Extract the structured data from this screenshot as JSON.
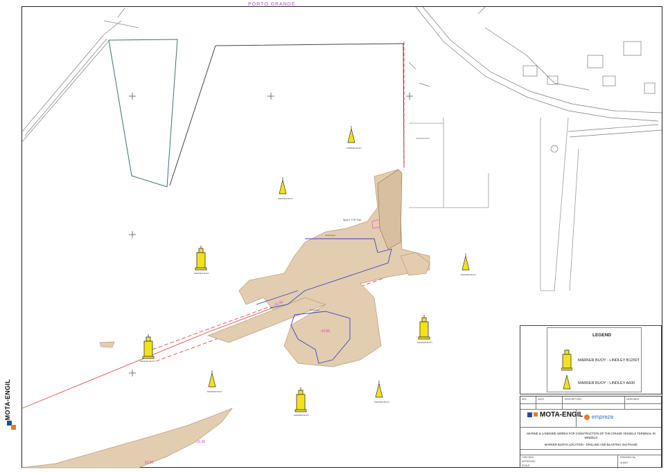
{
  "top_label": "PORTO GRANDE",
  "map_labels": {
    "spoil_area": "Spoil 1 TYP. Pad",
    "channel_depth_1": "-11.00",
    "channel_depth_2": "-10.00",
    "rock_area_1": "Rock Area",
    "rock_area_2": "Rock Area",
    "shore_1": "-10.00",
    "shore_2": "-10.00",
    "buoy_label": "MARKER BUOY"
  },
  "legend": {
    "title": "LEGEND",
    "items": [
      {
        "label": "MARKER BUOY - LINDLEY B1250T",
        "icon": "large-buoy-icon"
      },
      {
        "label": "MARKER BUOY - LINDLEY A600",
        "icon": "small-buoy-icon"
      }
    ]
  },
  "vertical_logo": "MOTA-ENGIL",
  "title_block": {
    "company_1": "MOTA-ENGIL",
    "company_2": "empreza",
    "project": "MARINE & LANDSIDE WORKS FOR CONSTRUCTION OF THE CRUISE VESSELS TERMINAL IN MINDELO",
    "drawing_title": "MARKER BUOYS LOCATION - DRILLING AND BLASTING 2nd PHASE",
    "fields": [
      "REV",
      "DATE",
      "DESCRIPTION",
      "DESIGNED",
      "CHECKED",
      "APPROVED",
      "SCALE",
      "DRAWING No.",
      "SHEET"
    ]
  },
  "colors": {
    "buoy": "#f3e21a",
    "land": "#e3cdb0",
    "channel_line": "#e24c4c",
    "boundary": "#3a44c2",
    "pink": "#e85ad2"
  }
}
